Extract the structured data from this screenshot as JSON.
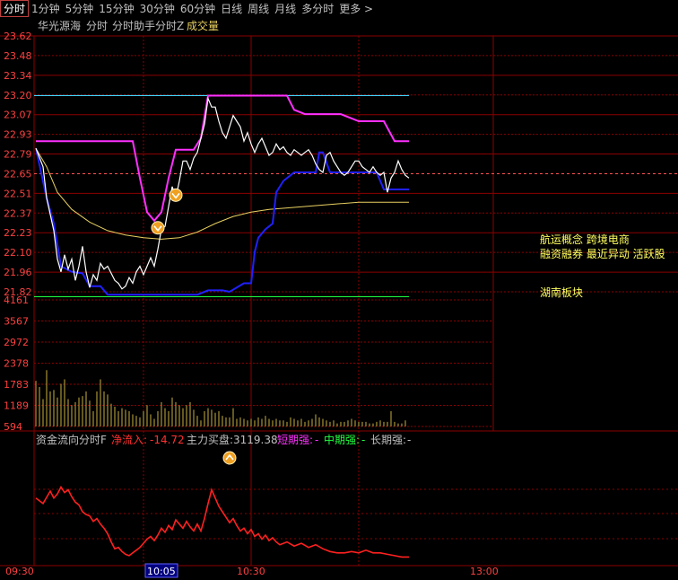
{
  "toolbar": {
    "tabs": [
      "分时",
      "1分钟",
      "5分钟",
      "15分钟",
      "30分钟",
      "60分钟",
      "日线",
      "周线",
      "月线",
      "多分时",
      "更多 >"
    ],
    "active_tab": "分时"
  },
  "colors": {
    "price": "#ffffff",
    "avg": "#e8d060",
    "magenta": "#ff30ff",
    "blue": "#2020ff",
    "cyan": "#40d8ff",
    "green": "#20ff40",
    "red": "#ff2020",
    "grid": "#8b0000",
    "axis_text": "#ff4040",
    "volume": "#c8b040"
  },
  "header": {
    "name": "华光源海",
    "items": [
      "分时",
      "分时助手分时Z"
    ],
    "volume_label": "成交量"
  },
  "annotations": {
    "concepts_1": "航运概念 跨境电商",
    "concepts_2": "融资融券 最近异动 活跃股",
    "sector": "湖南板块"
  },
  "money_flow": {
    "title": "资金流向分时F",
    "net_inflow_label": "净流入:",
    "net_inflow_value": "-14.72",
    "main_buy_label": "主力买盘:",
    "main_buy_value": "3119.38",
    "short_label": "短期强:",
    "short_value": "-",
    "mid_label": "中期强:",
    "mid_value": "-",
    "long_label": "长期强:",
    "long_value": "-"
  },
  "chart_data": {
    "type": "line",
    "price_ticks": [
      "23.62",
      "23.48",
      "23.34",
      "23.20",
      "23.07",
      "22.93",
      "22.79",
      "22.65",
      "22.51",
      "22.37",
      "22.23",
      "22.10",
      "21.96",
      "21.82"
    ],
    "ylim": [
      21.82,
      23.62
    ],
    "prev_close": 22.65,
    "x_ticks": [
      "09:30",
      "10:05",
      "10:30",
      "13:00"
    ],
    "x_tick_minutes": [
      0,
      35,
      60,
      120
    ],
    "cyan_level": 23.2,
    "green_level": 21.785,
    "price": [
      [
        0,
        22.83
      ],
      [
        2,
        22.7
      ],
      [
        3,
        22.48
      ],
      [
        5,
        22.25
      ],
      [
        6,
        22.05
      ],
      [
        7,
        21.96
      ],
      [
        8,
        22.08
      ],
      [
        9,
        21.98
      ],
      [
        10,
        22.05
      ],
      [
        11,
        21.9
      ],
      [
        12,
        22.0
      ],
      [
        13,
        22.14
      ],
      [
        14,
        21.96
      ],
      [
        15,
        21.85
      ],
      [
        16,
        21.94
      ],
      [
        17,
        21.9
      ],
      [
        18,
        22.02
      ],
      [
        19,
        21.98
      ],
      [
        20,
        22.0
      ],
      [
        21,
        21.95
      ],
      [
        22,
        21.9
      ],
      [
        23,
        21.88
      ],
      [
        24,
        21.84
      ],
      [
        25,
        21.86
      ],
      [
        26,
        21.92
      ],
      [
        27,
        21.88
      ],
      [
        28,
        21.96
      ],
      [
        29,
        22.0
      ],
      [
        30,
        21.94
      ],
      [
        31,
        22.0
      ],
      [
        32,
        22.06
      ],
      [
        33,
        22.0
      ],
      [
        34,
        22.12
      ],
      [
        35,
        22.26
      ],
      [
        36,
        22.28
      ],
      [
        37,
        22.42
      ],
      [
        38,
        22.56
      ],
      [
        39,
        22.48
      ],
      [
        40,
        22.6
      ],
      [
        41,
        22.74
      ],
      [
        42,
        22.74
      ],
      [
        43,
        22.68
      ],
      [
        44,
        22.76
      ],
      [
        45,
        22.8
      ],
      [
        46,
        22.9
      ],
      [
        47,
        23.0
      ],
      [
        48,
        23.18
      ],
      [
        49,
        23.12
      ],
      [
        50,
        23.12
      ],
      [
        51,
        23.02
      ],
      [
        52,
        22.94
      ],
      [
        53,
        22.9
      ],
      [
        54,
        22.98
      ],
      [
        55,
        23.06
      ],
      [
        56,
        23.02
      ],
      [
        57,
        22.98
      ],
      [
        58,
        22.88
      ],
      [
        59,
        22.94
      ],
      [
        60,
        22.86
      ],
      [
        61,
        22.8
      ],
      [
        62,
        22.86
      ],
      [
        63,
        22.9
      ],
      [
        64,
        22.84
      ],
      [
        65,
        22.78
      ],
      [
        66,
        22.8
      ],
      [
        67,
        22.86
      ],
      [
        68,
        22.82
      ],
      [
        69,
        22.84
      ],
      [
        70,
        22.8
      ],
      [
        71,
        22.78
      ],
      [
        72,
        22.82
      ],
      [
        73,
        22.8
      ],
      [
        74,
        22.78
      ],
      [
        75,
        22.8
      ],
      [
        76,
        22.82
      ],
      [
        77,
        22.78
      ],
      [
        78,
        22.72
      ],
      [
        79,
        22.68
      ],
      [
        80,
        22.66
      ],
      [
        81,
        22.78
      ],
      [
        82,
        22.8
      ],
      [
        83,
        22.74
      ],
      [
        84,
        22.7
      ],
      [
        85,
        22.66
      ],
      [
        86,
        22.64
      ],
      [
        87,
        22.66
      ],
      [
        88,
        22.7
      ],
      [
        89,
        22.74
      ],
      [
        90,
        22.74
      ],
      [
        91,
        22.7
      ],
      [
        92,
        22.68
      ],
      [
        93,
        22.66
      ],
      [
        94,
        22.7
      ],
      [
        95,
        22.66
      ],
      [
        96,
        22.64
      ],
      [
        97,
        22.66
      ],
      [
        98,
        22.52
      ],
      [
        99,
        22.62
      ],
      [
        100,
        22.66
      ],
      [
        101,
        22.74
      ],
      [
        102,
        22.68
      ],
      [
        103,
        22.64
      ],
      [
        104,
        22.62
      ]
    ],
    "avg": [
      [
        0,
        22.83
      ],
      [
        3,
        22.7
      ],
      [
        6,
        22.52
      ],
      [
        10,
        22.4
      ],
      [
        15,
        22.31
      ],
      [
        20,
        22.25
      ],
      [
        25,
        22.22
      ],
      [
        30,
        22.2
      ],
      [
        35,
        22.19
      ],
      [
        40,
        22.2
      ],
      [
        45,
        22.24
      ],
      [
        50,
        22.3
      ],
      [
        55,
        22.35
      ],
      [
        60,
        22.38
      ],
      [
        65,
        22.4
      ],
      [
        70,
        22.41
      ],
      [
        75,
        22.42
      ],
      [
        80,
        22.43
      ],
      [
        85,
        22.44
      ],
      [
        90,
        22.45
      ],
      [
        95,
        22.45
      ],
      [
        100,
        22.45
      ],
      [
        104,
        22.45
      ]
    ],
    "magenta": [
      [
        0,
        22.88
      ],
      [
        27,
        22.88
      ],
      [
        29,
        22.62
      ],
      [
        31,
        22.38
      ],
      [
        33,
        22.32
      ],
      [
        35,
        22.38
      ],
      [
        37,
        22.62
      ],
      [
        39,
        22.82
      ],
      [
        44,
        22.82
      ],
      [
        46,
        22.9
      ],
      [
        48,
        23.2
      ],
      [
        70,
        23.2
      ],
      [
        72,
        23.1
      ],
      [
        75,
        23.07
      ],
      [
        85,
        23.07
      ],
      [
        90,
        23.02
      ],
      [
        97,
        23.02
      ],
      [
        100,
        22.88
      ],
      [
        104,
        22.88
      ]
    ],
    "blue": [
      [
        0,
        22.83
      ],
      [
        3,
        22.48
      ],
      [
        5,
        22.3
      ],
      [
        7,
        22.0
      ],
      [
        10,
        21.96
      ],
      [
        13,
        21.95
      ],
      [
        15,
        21.86
      ],
      [
        18,
        21.86
      ],
      [
        20,
        21.8
      ],
      [
        28,
        21.8
      ],
      [
        45,
        21.8
      ],
      [
        48,
        21.83
      ],
      [
        52,
        21.83
      ],
      [
        54,
        21.82
      ],
      [
        58,
        21.88
      ],
      [
        60,
        21.88
      ],
      [
        61,
        22.1
      ],
      [
        62,
        22.2
      ],
      [
        64,
        22.26
      ],
      [
        66,
        22.3
      ],
      [
        67,
        22.52
      ],
      [
        69,
        22.6
      ],
      [
        71,
        22.64
      ],
      [
        72,
        22.66
      ],
      [
        78,
        22.66
      ],
      [
        79,
        22.8
      ],
      [
        80,
        22.8
      ],
      [
        82,
        22.66
      ],
      [
        95,
        22.66
      ],
      [
        97,
        22.54
      ],
      [
        104,
        22.54
      ]
    ],
    "markers": [
      [
        34,
        22.27
      ],
      [
        39,
        22.5
      ]
    ],
    "volume_ticks": [
      "4161",
      "3567",
      "2972",
      "2378",
      "1783",
      "1189",
      "594"
    ],
    "volume_max": 4161,
    "volume": [
      1500,
      1300,
      900,
      1850,
      1150,
      1200,
      950,
      1400,
      1550,
      900,
      700,
      800,
      950,
      1000,
      1150,
      850,
      500,
      1150,
      1550,
      1150,
      1050,
      750,
      650,
      500,
      600,
      550,
      500,
      400,
      350,
      300,
      500,
      700,
      400,
      250,
      500,
      800,
      600,
      500,
      950,
      800,
      700,
      600,
      700,
      800,
      550,
      350,
      200,
      500,
      600,
      550,
      450,
      500,
      350,
      300,
      300,
      600,
      250,
      300,
      250,
      200,
      250,
      200,
      300,
      250,
      350,
      250,
      200,
      250,
      200,
      200,
      150,
      300,
      250,
      200,
      250,
      150,
      200,
      250,
      400,
      300,
      250,
      200,
      150,
      200,
      100,
      150,
      150,
      200,
      250,
      200,
      150,
      150,
      150,
      100,
      100,
      150,
      200,
      150,
      150,
      500,
      150,
      100,
      100,
      200
    ],
    "netflow": [
      [
        0,
        -14.0
      ],
      [
        2,
        -18.0
      ],
      [
        4,
        -9.0
      ],
      [
        5,
        -14.0
      ],
      [
        6,
        -11.0
      ],
      [
        7,
        -6.0
      ],
      [
        8,
        -10.0
      ],
      [
        9,
        -8.0
      ],
      [
        10,
        -13.0
      ],
      [
        11,
        -17.0
      ],
      [
        12,
        -19.0
      ],
      [
        13,
        -24.0
      ],
      [
        14,
        -26.0
      ],
      [
        15,
        -27.0
      ],
      [
        16,
        -31.0
      ],
      [
        17,
        -29.0
      ],
      [
        18,
        -33.0
      ],
      [
        19,
        -36.0
      ],
      [
        20,
        -40.0
      ],
      [
        21,
        -46.0
      ],
      [
        22,
        -51.0
      ],
      [
        23,
        -50.0
      ],
      [
        24,
        -53.0
      ],
      [
        25,
        -55.0
      ],
      [
        26,
        -56.0
      ],
      [
        27,
        -54.0
      ],
      [
        28,
        -52.0
      ],
      [
        29,
        -50.0
      ],
      [
        30,
        -47.0
      ],
      [
        31,
        -44.0
      ],
      [
        32,
        -42.0
      ],
      [
        33,
        -45.0
      ],
      [
        34,
        -41.0
      ],
      [
        35,
        -36.0
      ],
      [
        36,
        -39.0
      ],
      [
        37,
        -34.0
      ],
      [
        38,
        -37.0
      ],
      [
        39,
        -30.0
      ],
      [
        40,
        -33.0
      ],
      [
        41,
        -36.0
      ],
      [
        42,
        -31.0
      ],
      [
        43,
        -35.0
      ],
      [
        44,
        -38.0
      ],
      [
        45,
        -33.0
      ],
      [
        46,
        -38.0
      ],
      [
        47,
        -29.0
      ],
      [
        48,
        -18.0
      ],
      [
        49,
        -8.0
      ],
      [
        50,
        -14.0
      ],
      [
        51,
        -20.0
      ],
      [
        52,
        -24.0
      ],
      [
        53,
        -28.0
      ],
      [
        54,
        -32.0
      ],
      [
        55,
        -29.0
      ],
      [
        56,
        -34.0
      ],
      [
        57,
        -38.0
      ],
      [
        58,
        -36.0
      ],
      [
        59,
        -40.0
      ],
      [
        60,
        -37.0
      ],
      [
        61,
        -42.0
      ],
      [
        62,
        -40.0
      ],
      [
        63,
        -44.0
      ],
      [
        64,
        -41.0
      ],
      [
        65,
        -45.0
      ],
      [
        66,
        -43.0
      ],
      [
        67,
        -46.0
      ],
      [
        68,
        -48.0
      ],
      [
        70,
        -46.0
      ],
      [
        72,
        -49.0
      ],
      [
        74,
        -47.0
      ],
      [
        76,
        -50.0
      ],
      [
        78,
        -48.0
      ],
      [
        80,
        -51.0
      ],
      [
        82,
        -53.0
      ],
      [
        84,
        -54.0
      ],
      [
        86,
        -54.0
      ],
      [
        88,
        -53.0
      ],
      [
        90,
        -54.0
      ],
      [
        92,
        -52.0
      ],
      [
        94,
        -54.0
      ],
      [
        96,
        -54.0
      ],
      [
        98,
        -55.0
      ],
      [
        100,
        -56.0
      ],
      [
        102,
        -57.0
      ],
      [
        104,
        -57.0
      ]
    ],
    "netflow_ylim": [
      -60,
      10
    ]
  }
}
